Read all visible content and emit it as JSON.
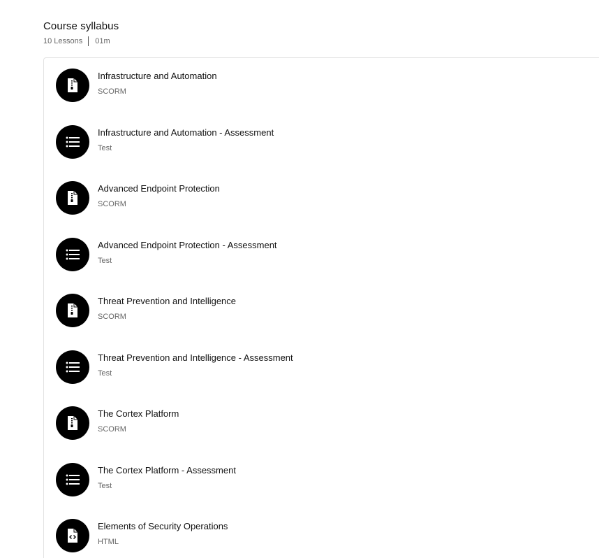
{
  "header": {
    "title": "Course syllabus",
    "lessons_count": "10 Lessons",
    "duration": "01m"
  },
  "lessons": [
    {
      "title": "Infrastructure and Automation",
      "type": "SCORM",
      "icon": "zip-file-icon"
    },
    {
      "title": "Infrastructure and Automation - Assessment",
      "type": "Test",
      "icon": "list-icon"
    },
    {
      "title": "Advanced Endpoint Protection",
      "type": "SCORM",
      "icon": "zip-file-icon"
    },
    {
      "title": "Advanced Endpoint Protection - Assessment",
      "type": "Test",
      "icon": "list-icon"
    },
    {
      "title": "Threat Prevention and Intelligence",
      "type": "SCORM",
      "icon": "zip-file-icon"
    },
    {
      "title": "Threat Prevention and Intelligence - Assessment",
      "type": "Test",
      "icon": "list-icon"
    },
    {
      "title": "The Cortex Platform",
      "type": "SCORM",
      "icon": "zip-file-icon"
    },
    {
      "title": "The Cortex Platform - Assessment",
      "type": "Test",
      "icon": "list-icon"
    },
    {
      "title": "Elements of Security Operations",
      "type": "HTML",
      "icon": "code-file-icon"
    }
  ],
  "colors": {
    "icon_bg": "#000000",
    "muted_text": "#666666"
  }
}
